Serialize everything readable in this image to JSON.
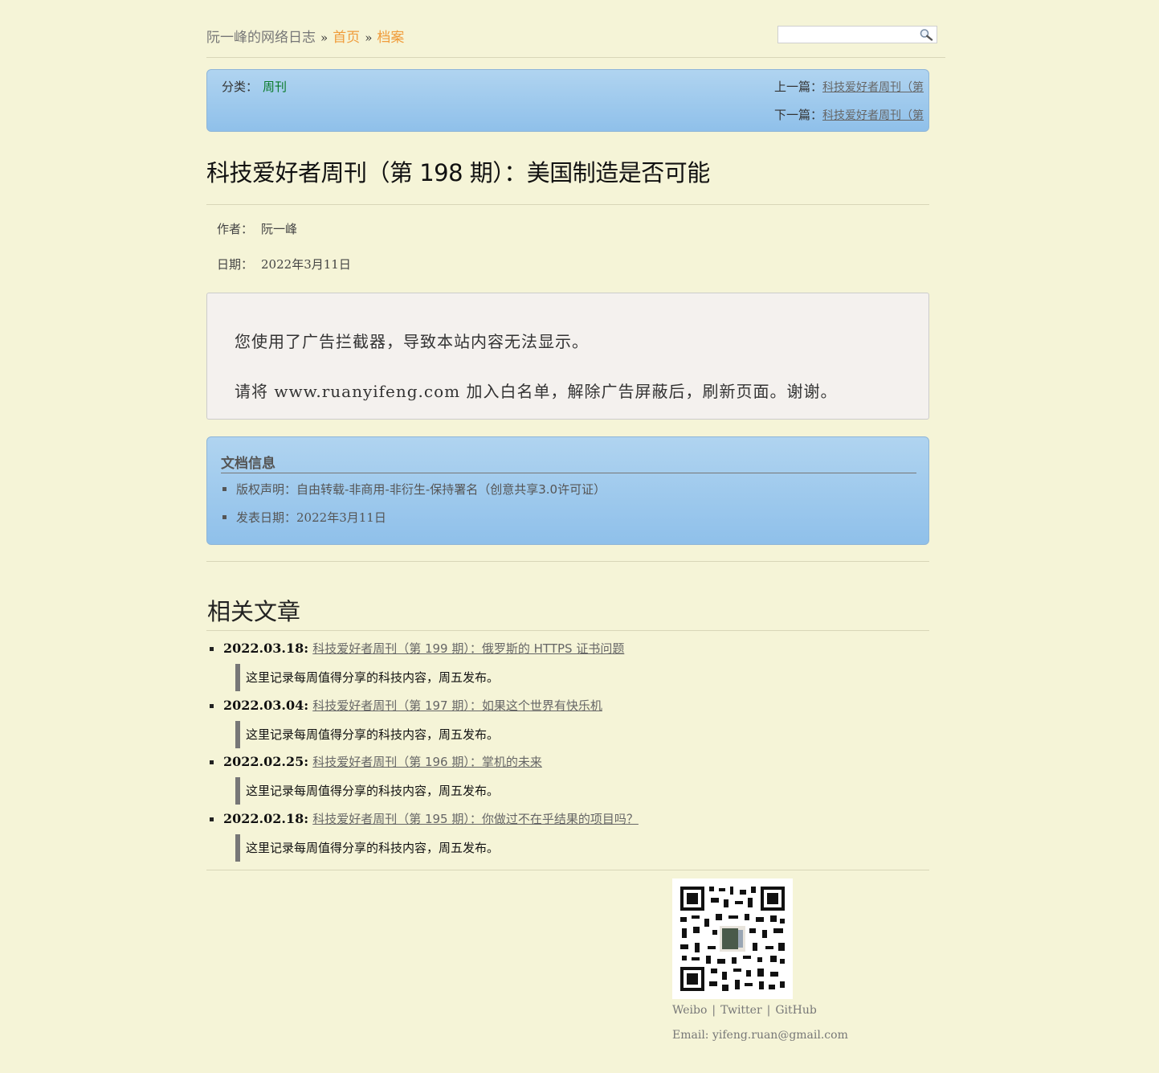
{
  "header": {
    "site_name": "阮一峰的网络日志",
    "sep1": "»",
    "home": "首页",
    "sep2": "»",
    "archive": "档案",
    "search_value": ""
  },
  "nav": {
    "category_label": "分类：",
    "category": "周刊",
    "prev_label": "上一篇：",
    "prev_title": "科技爱好者周刊（第",
    "next_label": "下一篇：",
    "next_title": "科技爱好者周刊（第"
  },
  "article": {
    "title": "科技爱好者周刊（第 198 期）：美国制造是否可能",
    "author_label": "作者：",
    "author": "阮一峰",
    "date_label": "日期：",
    "date": "2022年3月11日"
  },
  "notice": {
    "line1": "您使用了广告拦截器，导致本站内容无法显示。",
    "line2": "请将 www.ruanyifeng.com 加入白名单，解除广告屏蔽后，刷新页面。谢谢。"
  },
  "docinfo": {
    "heading": "文档信息",
    "license": "版权声明：自由转载-非商用-非衍生-保持署名（创意共享3.0许可证）",
    "pub_label": "发表日期：",
    "pub_date": "2022年3月11日"
  },
  "related": {
    "heading": "相关文章",
    "items": [
      {
        "date": "2022.03.18:",
        "title": "科技爱好者周刊（第 199 期）：俄罗斯的 HTTPS 证书问题",
        "summary": "这里记录每周值得分享的科技内容，周五发布。"
      },
      {
        "date": "2022.03.04:",
        "title": "科技爱好者周刊（第 197 期）：如果这个世界有快乐机",
        "summary": "这里记录每周值得分享的科技内容，周五发布。"
      },
      {
        "date": "2022.02.25:",
        "title": "科技爱好者周刊（第 196 期）：掌机的未来",
        "summary": "这里记录每周值得分享的科技内容，周五发布。"
      },
      {
        "date": "2022.02.18:",
        "title": "科技爱好者周刊（第 195 期）：你做过不在乎结果的项目吗？",
        "summary": "这里记录每周值得分享的科技内容，周五发布。"
      }
    ]
  },
  "footer": {
    "weibo": "Weibo",
    "twitter": "Twitter",
    "github": "GitHub",
    "bar": "|",
    "email": "Email: yifeng.ruan@gmail.com"
  }
}
